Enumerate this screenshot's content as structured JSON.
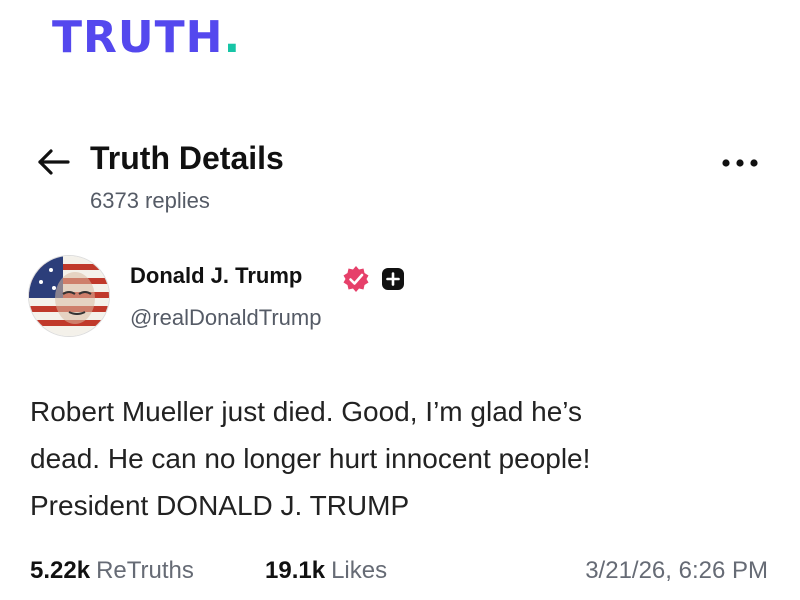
{
  "app": {
    "logo_text": "TRUTH",
    "logo_dot": ".",
    "logo_color": "#5448ee",
    "logo_dot_color": "#17c5a6"
  },
  "header": {
    "back_icon": "arrow-left-icon",
    "title": "Truth Details",
    "replies": "6373 replies",
    "more_icon": "ellipsis-horizontal-icon"
  },
  "author": {
    "display_name": "Donald J. Trump",
    "handle": "@realDonaldTrump",
    "verified_icon": "verified-badge-icon",
    "verified_color": "#e6406a",
    "plus_icon": "plus-badge-icon"
  },
  "post": {
    "lines": [
      "Robert Mueller just died. Good, I’m glad he’s",
      "dead. He can no longer hurt innocent people!",
      "President DONALD J. TRUMP"
    ]
  },
  "stats": {
    "retruths_count": "5.22k",
    "retruths_label": "ReTruths",
    "likes_count": "19.1k",
    "likes_label": "Likes",
    "timestamp": "3/21/26, 6:26 PM"
  }
}
